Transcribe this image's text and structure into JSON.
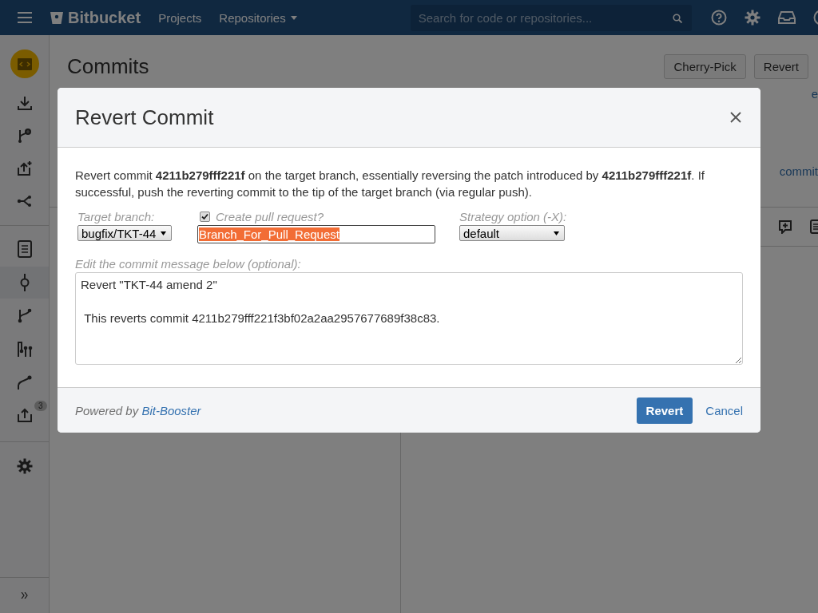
{
  "header": {
    "brand": "Bitbucket",
    "nav": [
      {
        "label": "Projects",
        "dropdown": false
      },
      {
        "label": "Repositories",
        "dropdown": true
      }
    ],
    "search": {
      "placeholder": "Search for code or repositories..."
    }
  },
  "sidebar": {
    "badge": "3"
  },
  "page": {
    "title": "Commits",
    "buttons": [
      "Cherry-Pick",
      "Revert"
    ],
    "fragments": [
      "e",
      "commit"
    ]
  },
  "modal": {
    "title": "Revert Commit",
    "description": "Revert commit **4211b279fff221f** on the target branch, essentially reversing the patch introduced by **4211b279fff221f**. If successful, push the reverting commit to the tip of the target branch (via regular push).",
    "target_branch": {
      "label": "Target branch:",
      "value": "bugfix/TKT-44"
    },
    "pull_request": {
      "label": "Create pull request?",
      "checked": true,
      "value": "Branch_For_Pull_Request",
      "text_selected": true
    },
    "strategy": {
      "label": "Strategy option (-X):",
      "value": "default"
    },
    "message": {
      "label": "Edit the commit message below (optional):",
      "value": "Revert \"TKT-44 amend 2\"\n\n This reverts commit 4211b279fff221f3bf02a2aa2957677689f38c83."
    },
    "footer": {
      "powered_by": "Powered by",
      "link": "Bit-Booster"
    },
    "buttons": {
      "primary": "Revert",
      "cancel": "Cancel"
    }
  }
}
